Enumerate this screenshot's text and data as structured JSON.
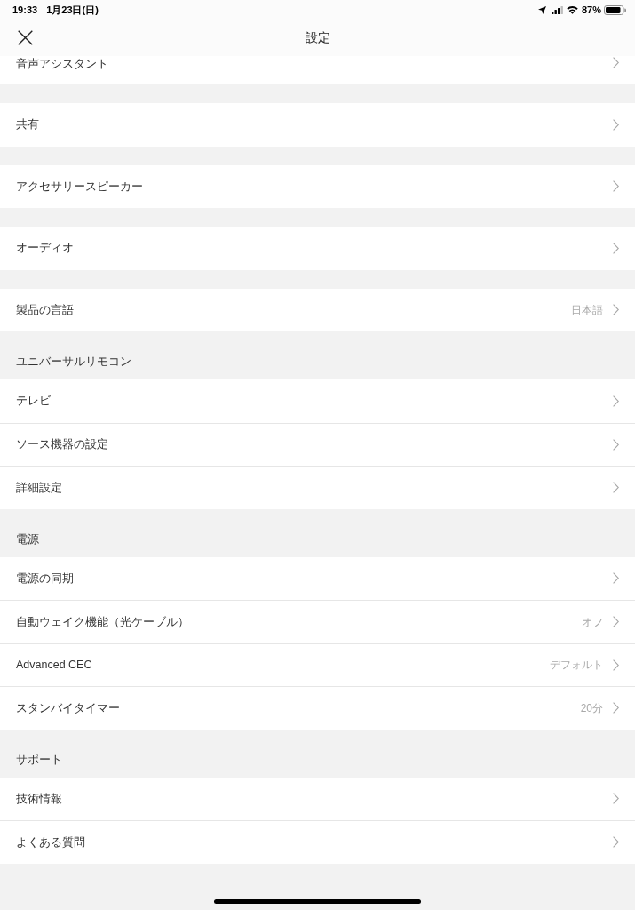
{
  "status_bar": {
    "time": "19:33",
    "date": "1月23日(日)",
    "battery": "87%"
  },
  "header": {
    "title": "設定"
  },
  "sections": [
    {
      "rows": [
        {
          "label": "音声アシスタント"
        }
      ]
    },
    {
      "rows": [
        {
          "label": "共有"
        }
      ]
    },
    {
      "rows": [
        {
          "label": "アクセサリースピーカー"
        }
      ]
    },
    {
      "rows": [
        {
          "label": "オーディオ"
        }
      ]
    },
    {
      "rows": [
        {
          "label": "製品の言語",
          "value": "日本語"
        }
      ]
    },
    {
      "title": "ユニバーサルリモコン",
      "rows": [
        {
          "label": "テレビ"
        },
        {
          "label": "ソース機器の設定"
        },
        {
          "label": "詳細設定"
        }
      ]
    },
    {
      "title": "電源",
      "rows": [
        {
          "label": "電源の同期"
        },
        {
          "label": "自動ウェイク機能（光ケーブル）",
          "value": "オフ"
        },
        {
          "label": "Advanced CEC",
          "value": "デフォルト"
        },
        {
          "label": "スタンバイタイマー",
          "value": "20分"
        }
      ]
    },
    {
      "title": "サポート",
      "rows": [
        {
          "label": "技術情報"
        },
        {
          "label": "よくある質問"
        }
      ]
    }
  ]
}
